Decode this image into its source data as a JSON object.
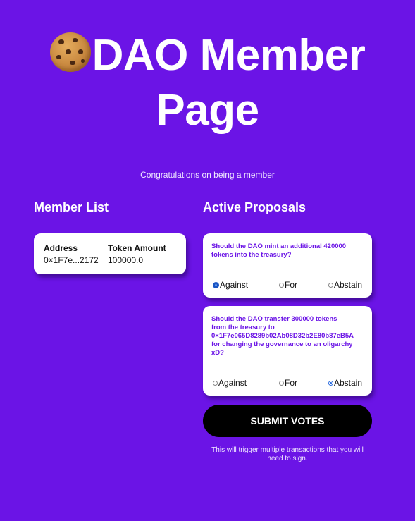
{
  "header": {
    "icon": "cookie-icon",
    "title_line1": "DAO Member",
    "title_line2": "Page",
    "subtitle": "Congratulations on being a member"
  },
  "colors": {
    "background": "#6b14e6",
    "card": "#ffffff",
    "question_text": "#6b14e6",
    "button": "#000000",
    "radio_selected": "#2f6fe0"
  },
  "member_list": {
    "title": "Member List",
    "columns": [
      "Address",
      "Token Amount"
    ],
    "rows": [
      {
        "address": "0×1F7e...2172",
        "token_amount": "100000.0"
      }
    ]
  },
  "proposals": {
    "title": "Active Proposals",
    "items": [
      {
        "question_lines": [
          "Should the DAO mint an additional 420000",
          "tokens into the treasury?"
        ],
        "options": [
          "Against",
          "For",
          "Abstain"
        ],
        "selected": "Against"
      },
      {
        "question_lines": [
          "Should the DAO transfer 300000 tokens",
          "from the treasury to",
          "0×1F7e065D8289b02Ab08D32b2E80b87eB5A",
          "for changing the governance to an oligarchy",
          "xD?"
        ],
        "options": [
          "Against",
          "For",
          "Abstain"
        ],
        "selected": "Abstain"
      }
    ]
  },
  "submit": {
    "label": "SUBMIT VOTES",
    "note": "This will trigger multiple transactions that you will need to sign."
  }
}
